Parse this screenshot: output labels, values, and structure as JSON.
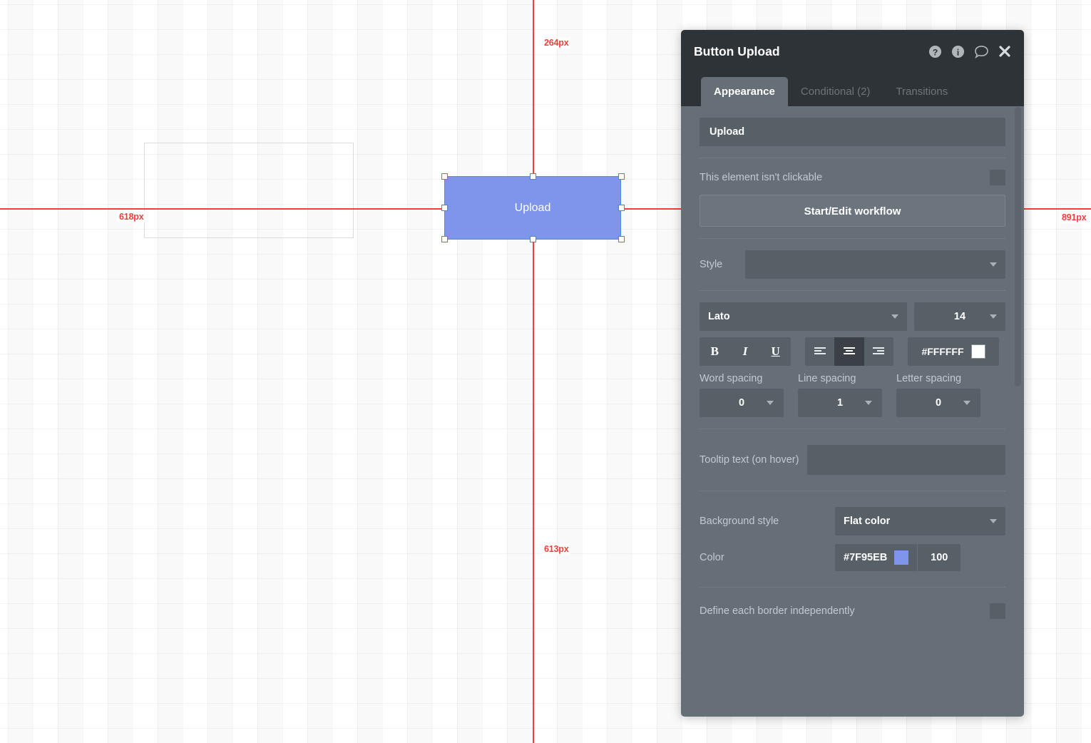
{
  "canvas": {
    "element": {
      "label": "Upload"
    },
    "guides": [
      {
        "name": "guide-top",
        "value": "264px"
      },
      {
        "name": "guide-left",
        "value": "618px"
      },
      {
        "name": "guide-bottom",
        "value": "613px"
      },
      {
        "name": "guide-right",
        "value": "891px"
      }
    ]
  },
  "panel": {
    "title": "Button Upload",
    "icons": {
      "help": "help-icon",
      "info": "info-icon",
      "comment": "comment-icon",
      "close": "close-icon"
    },
    "tabs": [
      {
        "label": "Appearance",
        "active": true
      },
      {
        "label": "Conditional (2)",
        "active": false
      },
      {
        "label": "Transitions",
        "active": false
      }
    ],
    "text_field": {
      "value": "Upload"
    },
    "clickable": {
      "label": "This element isn't clickable",
      "checked": false
    },
    "workflow_button": {
      "label": "Start/Edit workflow"
    },
    "style": {
      "label": "Style",
      "value": ""
    },
    "font": {
      "family": "Lato",
      "size": "14",
      "bold": "B",
      "italic": "I",
      "underline": "U",
      "align_left": "align-left",
      "align_center": "align-center",
      "align_right": "align-right",
      "active_align": "center",
      "color_hex": "#FFFFFF",
      "color_value": "#ffffff"
    },
    "spacing": {
      "word_label": "Word spacing",
      "word_value": "0",
      "line_label": "Line spacing",
      "line_value": "1",
      "letter_label": "Letter spacing",
      "letter_value": "0"
    },
    "tooltip": {
      "label": "Tooltip text (on hover)",
      "value": ""
    },
    "background": {
      "style_label": "Background style",
      "style_value": "Flat color",
      "color_label": "Color",
      "color_hex": "#7F95EB",
      "color_swatch": "#7f95eb",
      "opacity": "100"
    },
    "border": {
      "label": "Define each border independently",
      "checked": false
    }
  }
}
